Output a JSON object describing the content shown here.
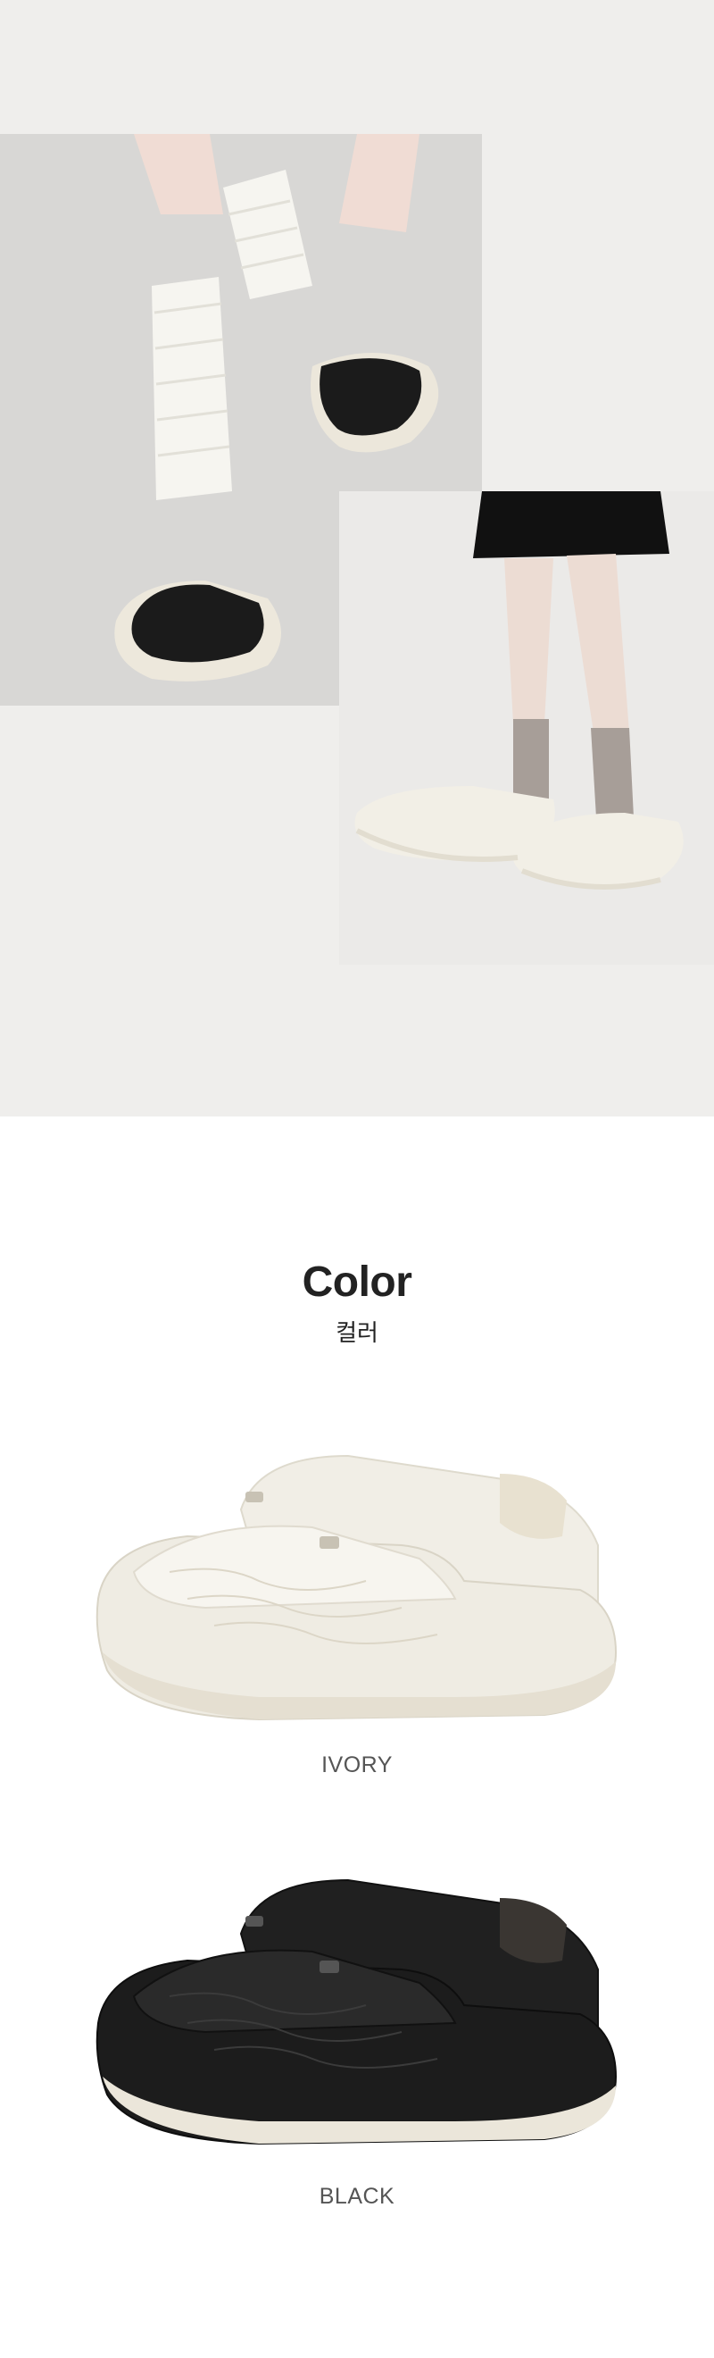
{
  "color_section": {
    "title": "Color",
    "subtitle": "컬러"
  },
  "variants": [
    {
      "label": "IVORY",
      "upper_color": "#f3f0e7",
      "sole_color": "#ebe6db"
    },
    {
      "label": "BLACK",
      "upper_color": "#1c1c1c",
      "sole_color": "#ede8dc"
    }
  ],
  "colors": {
    "lifestyle_background": "#efeeec",
    "page_background": "#ffffff",
    "title_text": "#222222",
    "label_text": "#555555"
  }
}
